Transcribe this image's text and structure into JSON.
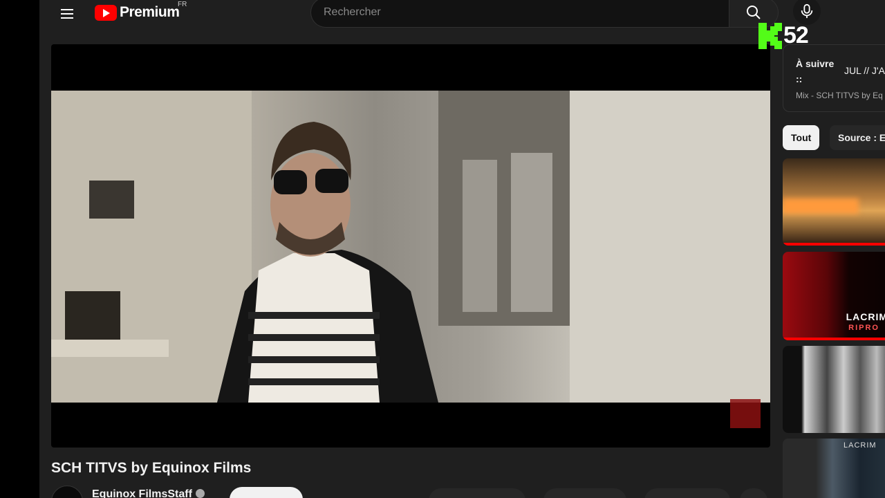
{
  "header": {
    "logo_text": "Premium",
    "country": "FR",
    "search_placeholder": "Rechercher"
  },
  "overlay_badge": {
    "count": "52",
    "color": "#53fc18"
  },
  "video": {
    "title": "SCH TITVS by Equinox Films",
    "channel": "Equinox FilmsStaff"
  },
  "up_next": {
    "label": "À suivre ::",
    "title": "JUL // J'A",
    "subtitle": "Mix - SCH TITVS by Eq"
  },
  "chips": [
    "Tout",
    "Source : E"
  ],
  "thumbnails": {
    "t2_text": "LACRIM",
    "t2_sub": "RIPRO",
    "t4_text": "LACRIM"
  },
  "colors": {
    "background": "#1f1f1f",
    "brand_red": "#ff0000",
    "chip_active": "#f1f1f1"
  }
}
